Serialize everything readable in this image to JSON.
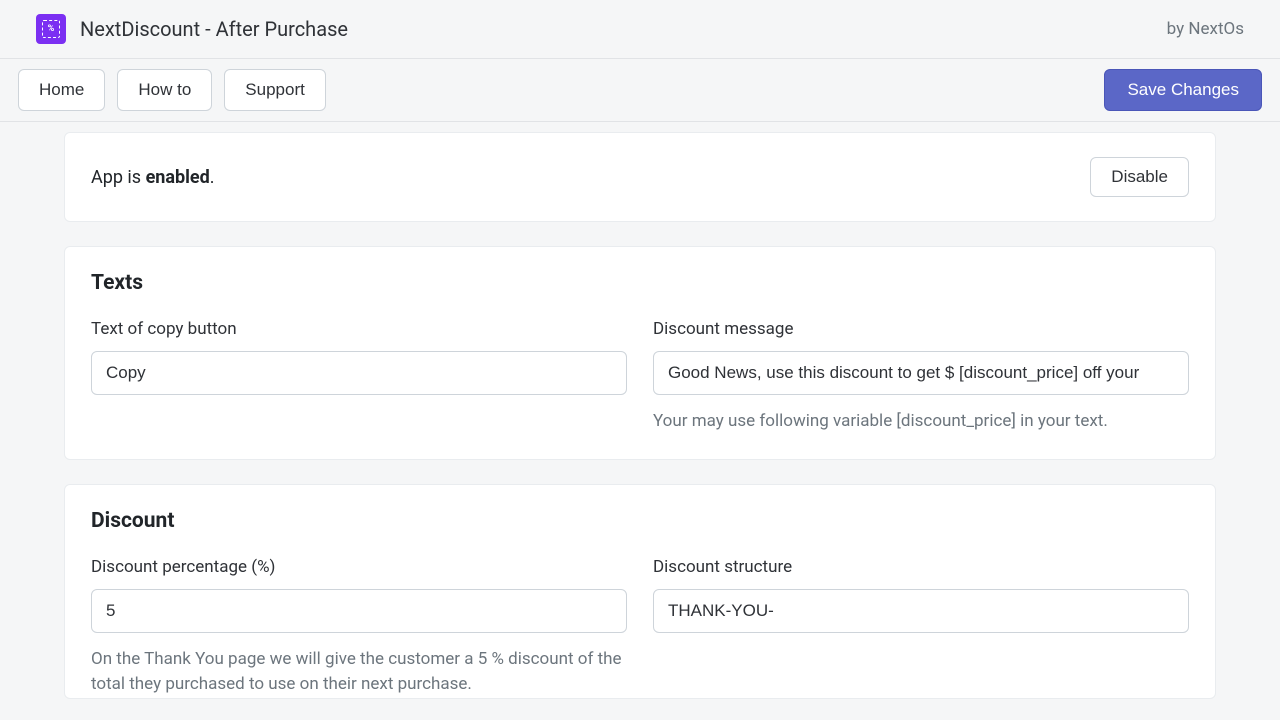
{
  "header": {
    "app_title": "NextDiscount - After Purchase",
    "byline": "by NextOs"
  },
  "nav": {
    "home": "Home",
    "howto": "How to",
    "support": "Support",
    "save": "Save Changes"
  },
  "status": {
    "prefix": "App is ",
    "state": "enabled",
    "suffix": ".",
    "disable_label": "Disable"
  },
  "texts_section": {
    "title": "Texts",
    "copy_label": "Text of copy button",
    "copy_value": "Copy",
    "msg_label": "Discount message",
    "msg_value": "Good News, use this discount to get $ [discount_price] off your",
    "msg_help": "Your may use following variable [discount_price] in your text."
  },
  "discount_section": {
    "title": "Discount",
    "pct_label": "Discount percentage (%)",
    "pct_value": "5",
    "pct_help": "On the Thank You page we will give the customer a 5 % discount of the total they purchased to use on their next purchase.",
    "struct_label": "Discount structure",
    "struct_value": "THANK-YOU-"
  }
}
